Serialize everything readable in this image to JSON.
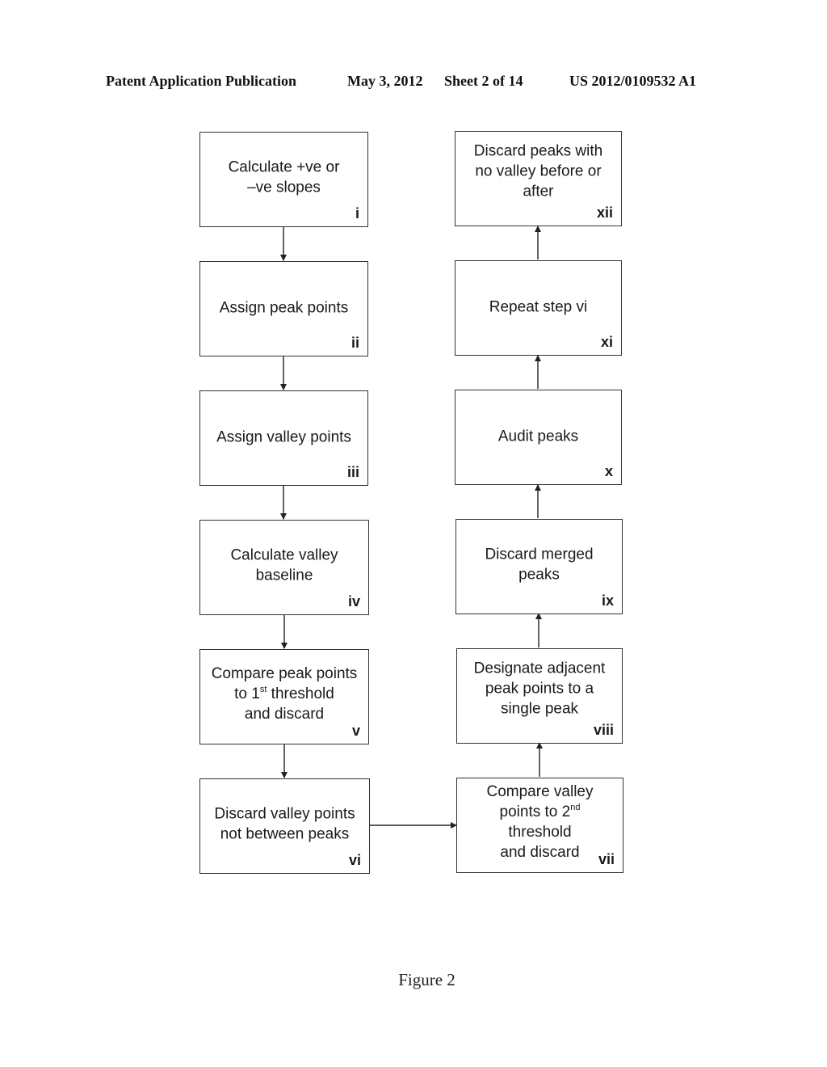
{
  "header": {
    "publication": "Patent Application Publication",
    "date": "May 3, 2012",
    "sheet": "Sheet 2 of 14",
    "number": "US 2012/0109532 A1"
  },
  "steps": [
    {
      "id": "i",
      "lines": [
        "Calculate +ve or",
        "–ve slopes"
      ]
    },
    {
      "id": "ii",
      "lines": [
        "Assign peak points"
      ]
    },
    {
      "id": "iii",
      "lines": [
        "Assign valley points"
      ]
    },
    {
      "id": "iv",
      "lines": [
        "Calculate valley",
        "baseline"
      ]
    },
    {
      "id": "v",
      "line1": "Compare peak points",
      "line2_pre": "to 1",
      "line2_sup": "st",
      "line2_post": " threshold",
      "line3": "and discard"
    },
    {
      "id": "vi",
      "lines": [
        "Discard valley points",
        "not between peaks"
      ]
    },
    {
      "id": "vii",
      "line1": "Compare valley",
      "line2_pre": "points to 2",
      "line2_sup": "nd",
      "line3": "threshold",
      "line4": "and discard"
    },
    {
      "id": "viii",
      "lines": [
        "Designate adjacent",
        "peak points to a",
        "single peak"
      ]
    },
    {
      "id": "ix",
      "lines": [
        "Discard merged",
        "peaks"
      ]
    },
    {
      "id": "x",
      "lines": [
        "Audit peaks"
      ]
    },
    {
      "id": "xi",
      "lines": [
        "Repeat step vi"
      ]
    },
    {
      "id": "xii",
      "lines": [
        "Discard peaks with",
        "no valley before or",
        "after"
      ]
    }
  ],
  "flow": [
    "i",
    "ii",
    "iii",
    "iv",
    "v",
    "vi",
    "vii",
    "viii",
    "ix",
    "x",
    "xi",
    "xii"
  ],
  "caption": "Figure 2"
}
